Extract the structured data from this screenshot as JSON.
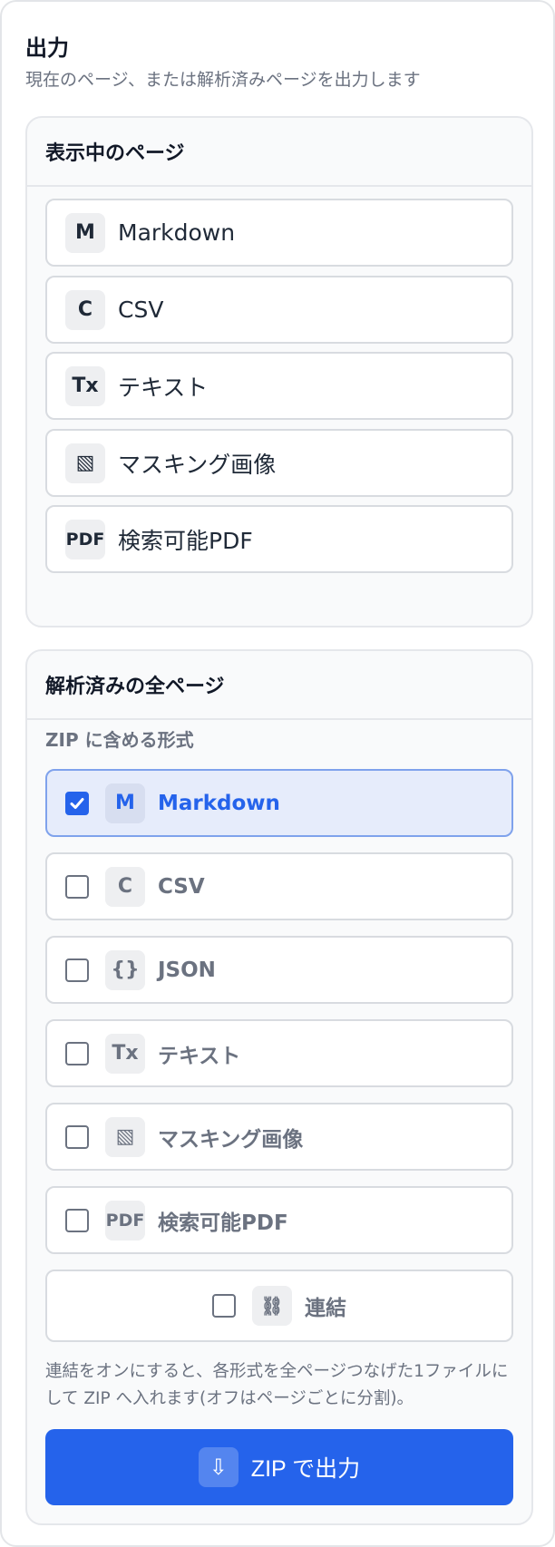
{
  "panel": {
    "title": "出力",
    "subtitle": "現在のページ、または解析済みページを出力します"
  },
  "current_page": {
    "header": "表示中のページ",
    "options": [
      {
        "badge": "M",
        "label": "Markdown"
      },
      {
        "badge": "C",
        "label": "CSV"
      },
      {
        "badge": "Tx",
        "label": "テキスト"
      },
      {
        "badge": "▧",
        "label": "マスキング画像"
      },
      {
        "badge": "PDF",
        "label": "検索可能PDF"
      }
    ]
  },
  "all_pages": {
    "header": "解析済みの全ページ",
    "section_label": "ZIP に含める形式",
    "formats": [
      {
        "badge": "M",
        "label": "Markdown",
        "checked": true
      },
      {
        "badge": "C",
        "label": "CSV",
        "checked": false
      },
      {
        "badge": "{}",
        "label": "JSON",
        "checked": false
      },
      {
        "badge": "Tx",
        "label": "テキスト",
        "checked": false
      },
      {
        "badge": "▧",
        "label": "マスキング画像",
        "checked": false
      },
      {
        "badge": "PDF",
        "label": "検索可能PDF",
        "checked": false
      }
    ],
    "concat": {
      "badge": "⛓",
      "label": "連結",
      "checked": false
    },
    "note": "連結をオンにすると、各形式を全ページつなげた1ファイルにして ZIP へ入れます(オフはページごとに分割)。",
    "zip_button": {
      "icon": "⇩",
      "label": "ZIP で出力"
    }
  },
  "colors": {
    "accent": "#2563eb",
    "checked_bg": "#e6ecfb"
  }
}
